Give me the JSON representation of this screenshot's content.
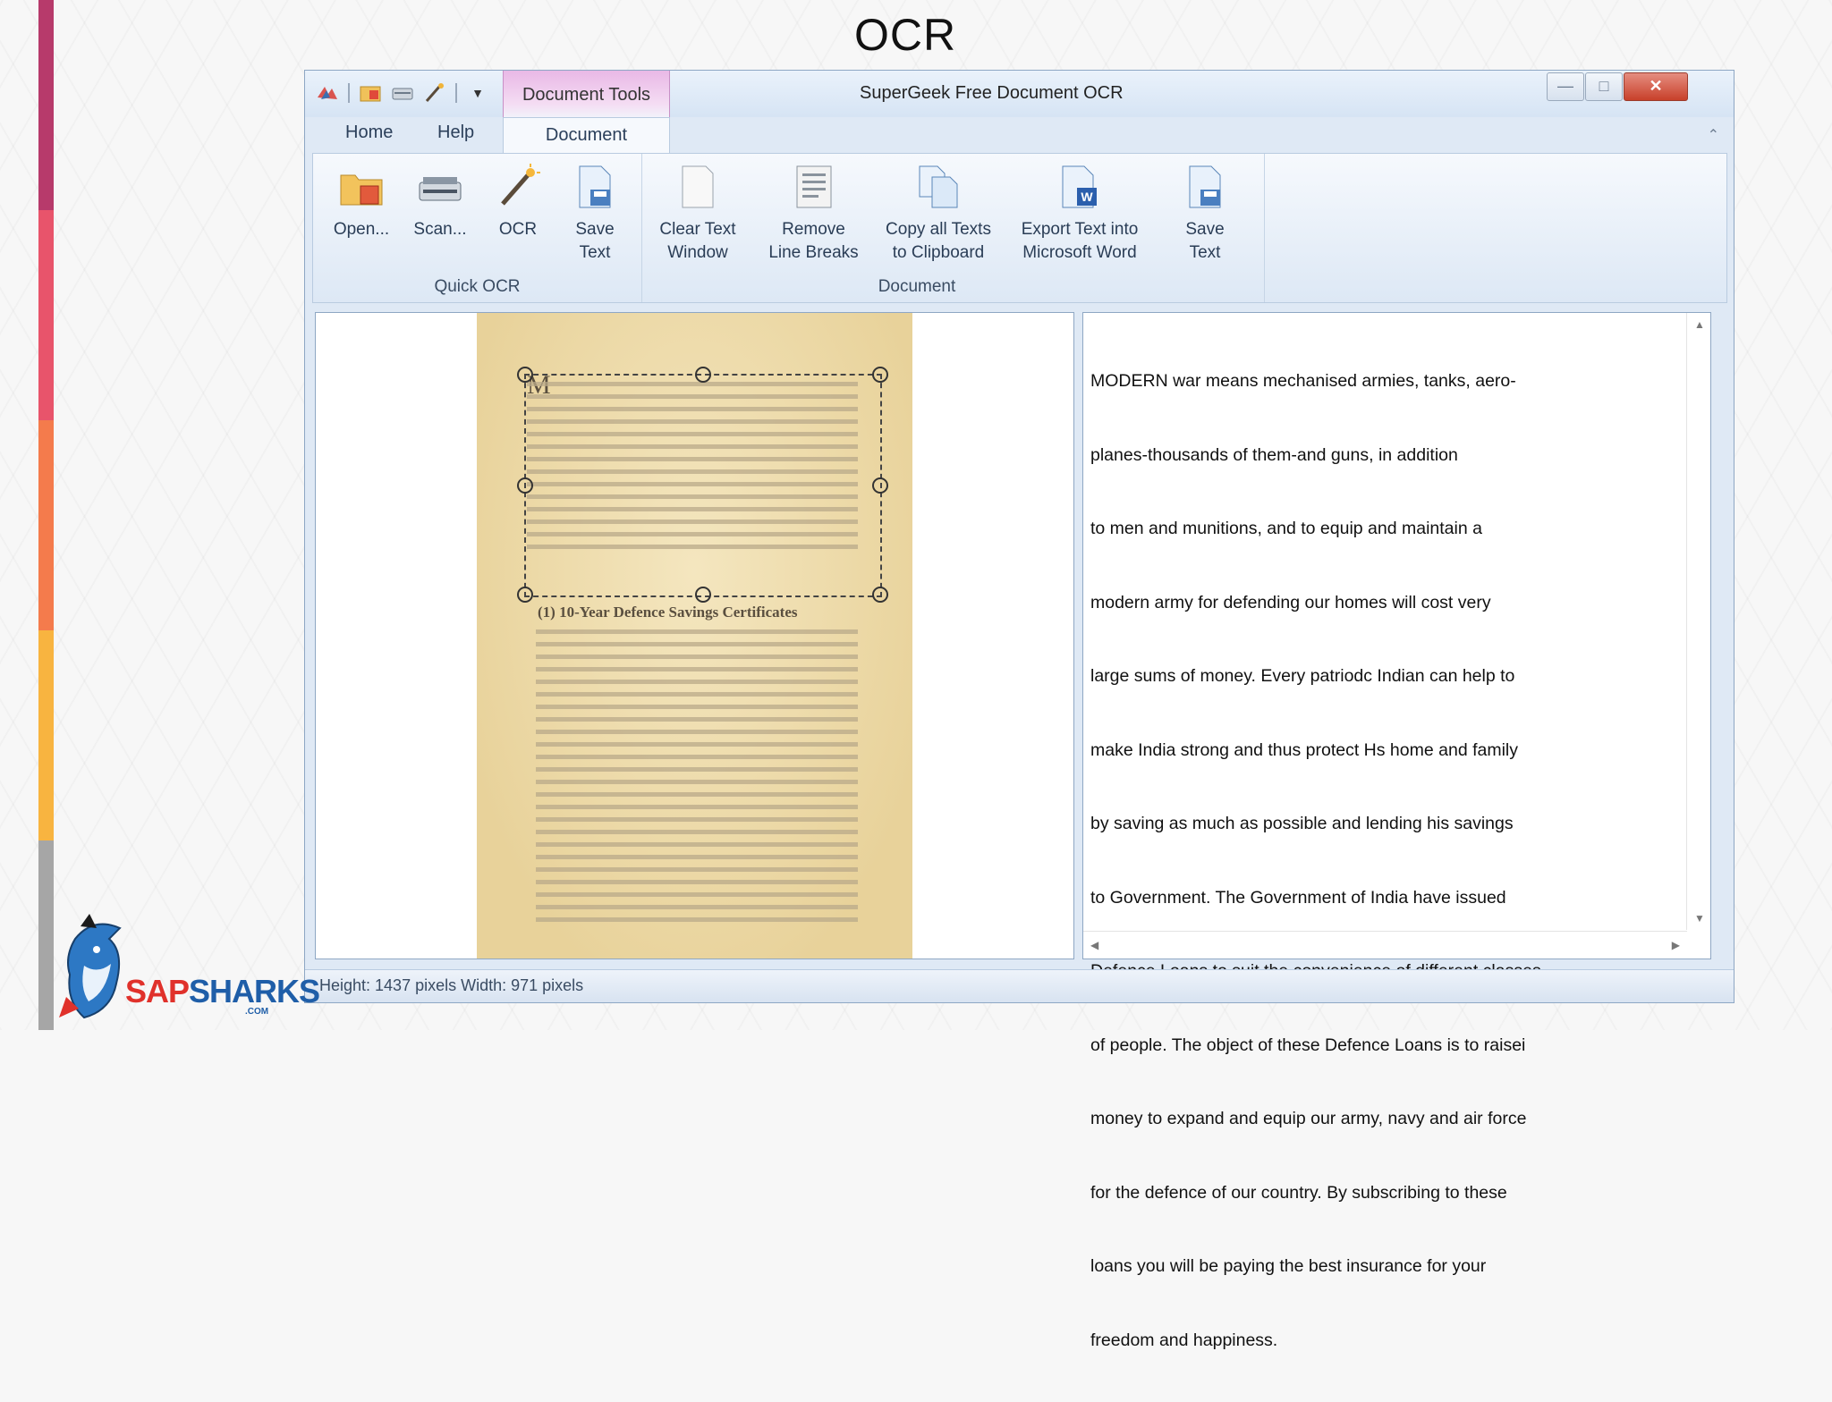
{
  "slide": {
    "title": "OCR",
    "sidebar_colors": [
      "#b73a6b",
      "#e8546b",
      "#f47b4c",
      "#f8b440",
      "#a6a6a6"
    ]
  },
  "window": {
    "title": "SuperGeek Free Document OCR",
    "context_tab": "Document Tools",
    "tabs": [
      "Home",
      "Help",
      "Document"
    ],
    "active_tab": "Document",
    "controls": {
      "minimize": "—",
      "maximize": "□",
      "close": "✕"
    }
  },
  "ribbon": {
    "groups": [
      {
        "label": "Quick OCR",
        "buttons": [
          {
            "label": "Open...",
            "icon": "folder-icon"
          },
          {
            "label": "Scan...",
            "icon": "scanner-icon"
          },
          {
            "label": "OCR",
            "icon": "magic-wand-icon"
          }
        ]
      },
      {
        "label": "Document",
        "buttons": [
          {
            "label": "Save\nText",
            "icon": "save-text-icon"
          },
          {
            "label": "Clear Text\nWindow",
            "icon": "blank-page-icon"
          },
          {
            "label": "Remove\nLine Breaks",
            "icon": "document-lines-icon"
          },
          {
            "label": "Copy all Texts\nto Clipboard",
            "icon": "copy-pages-icon"
          },
          {
            "label": "Export Text into\nMicrosoft Word",
            "icon": "word-document-icon"
          },
          {
            "label": "Save\nText",
            "icon": "save-text-icon"
          }
        ]
      }
    ]
  },
  "image_pane": {
    "document_heading": "(1) 10-Year Defence Savings Certificates",
    "drop_cap": "M"
  },
  "text_pane": {
    "lines": [
      "MODERN war means mechanised armies, tanks, aero-",
      "planes-thousands of them-and guns, in addition",
      "to men and munitions, and to equip and maintain a",
      "modern army for defending our homes will cost very",
      "large sums of money. Every patriodc Indian can help to",
      "make India strong and thus protect Hs home and family",
      "by saving as much as possible and lending his savings",
      "to Government. The Government of India have issued",
      "Defence Loans to suit the convenience of different classes",
      "of people. The object of these Defence Loans is to raisei",
      "money to expand and equip our army, navy and air force",
      "for the defence of our country. By subscribing to these",
      "loans you will be paying the best insurance for your",
      "freedom and happiness."
    ]
  },
  "status": {
    "text": "Height: 1437 pixels  Width: 971 pixels"
  },
  "logo": {
    "text_sap": "SAP",
    "text_sharks": "SHARKS",
    "sub": ".COM",
    "colors": {
      "sap": "#e0312b",
      "sharks": "#1f5ea8"
    }
  }
}
